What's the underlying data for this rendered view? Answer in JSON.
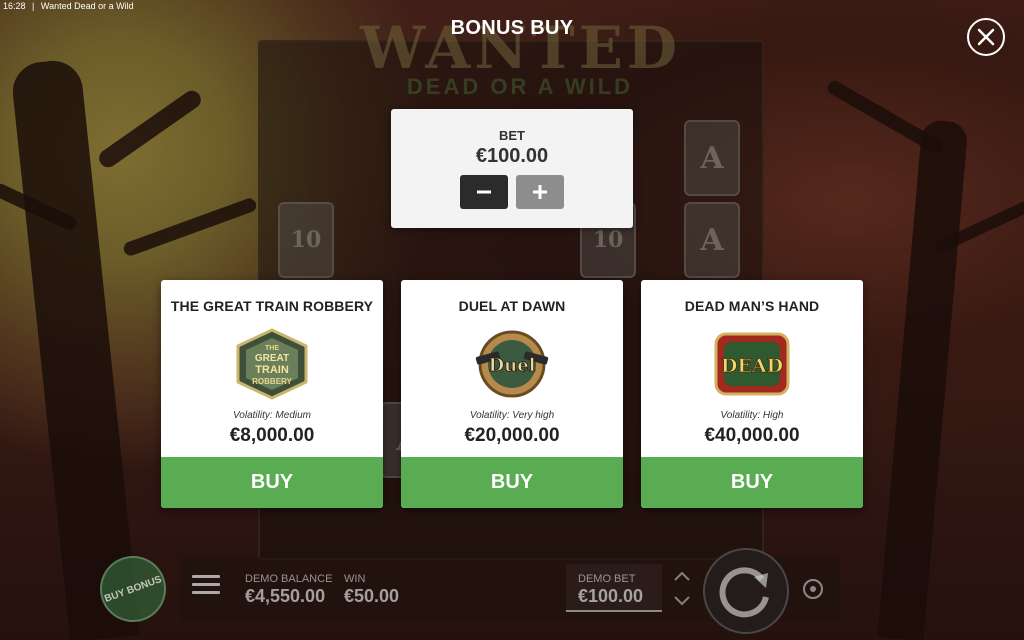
{
  "status_bar": {
    "time": "16:28",
    "app_title": "Wanted Dead or a Wild"
  },
  "background": {
    "logo_main": "WANTED",
    "logo_sub": "DEAD OR A WILD",
    "reel_symbols": [
      "A",
      "A",
      "10",
      "A",
      "10",
      "A"
    ]
  },
  "modal": {
    "title": "BONUS BUY",
    "close_icon": "close-icon",
    "bet": {
      "label": "BET",
      "value": "€100.00",
      "decrease_icon": "minus-icon",
      "increase_icon": "plus-icon"
    },
    "options": [
      {
        "title": "THE GREAT TRAIN ROBBERY",
        "icon": "train-robbery-badge-icon",
        "icon_text": [
          "THE",
          "GREAT",
          "TRAIN",
          "ROBBERY"
        ],
        "volatility": "Volatility: Medium",
        "price": "€8,000.00",
        "buy_label": "BUY"
      },
      {
        "title": "DUEL AT DAWN",
        "icon": "duel-badge-icon",
        "icon_text": [
          "Duel"
        ],
        "volatility": "Volatility: Very high",
        "price": "€20,000.00",
        "buy_label": "BUY"
      },
      {
        "title": "DEAD MAN’S HAND",
        "icon": "dead-badge-icon",
        "icon_text": [
          "DEAD"
        ],
        "volatility": "Volatility: High",
        "price": "€40,000.00",
        "buy_label": "BUY"
      }
    ]
  },
  "bottom_bar": {
    "buy_bonus_label": "BUY BONUS",
    "balance_label": "DEMO BALANCE",
    "balance_value": "€4,550.00",
    "win_label": "WIN",
    "win_value": "€50.00",
    "bet_label": "DEMO BET",
    "bet_value": "€100.00"
  },
  "colors": {
    "buy_button": "#5aac52",
    "card_background": "#ffffff",
    "bet_minus_button": "#2b2b2b",
    "bet_plus_button": "#8d8d8d"
  }
}
